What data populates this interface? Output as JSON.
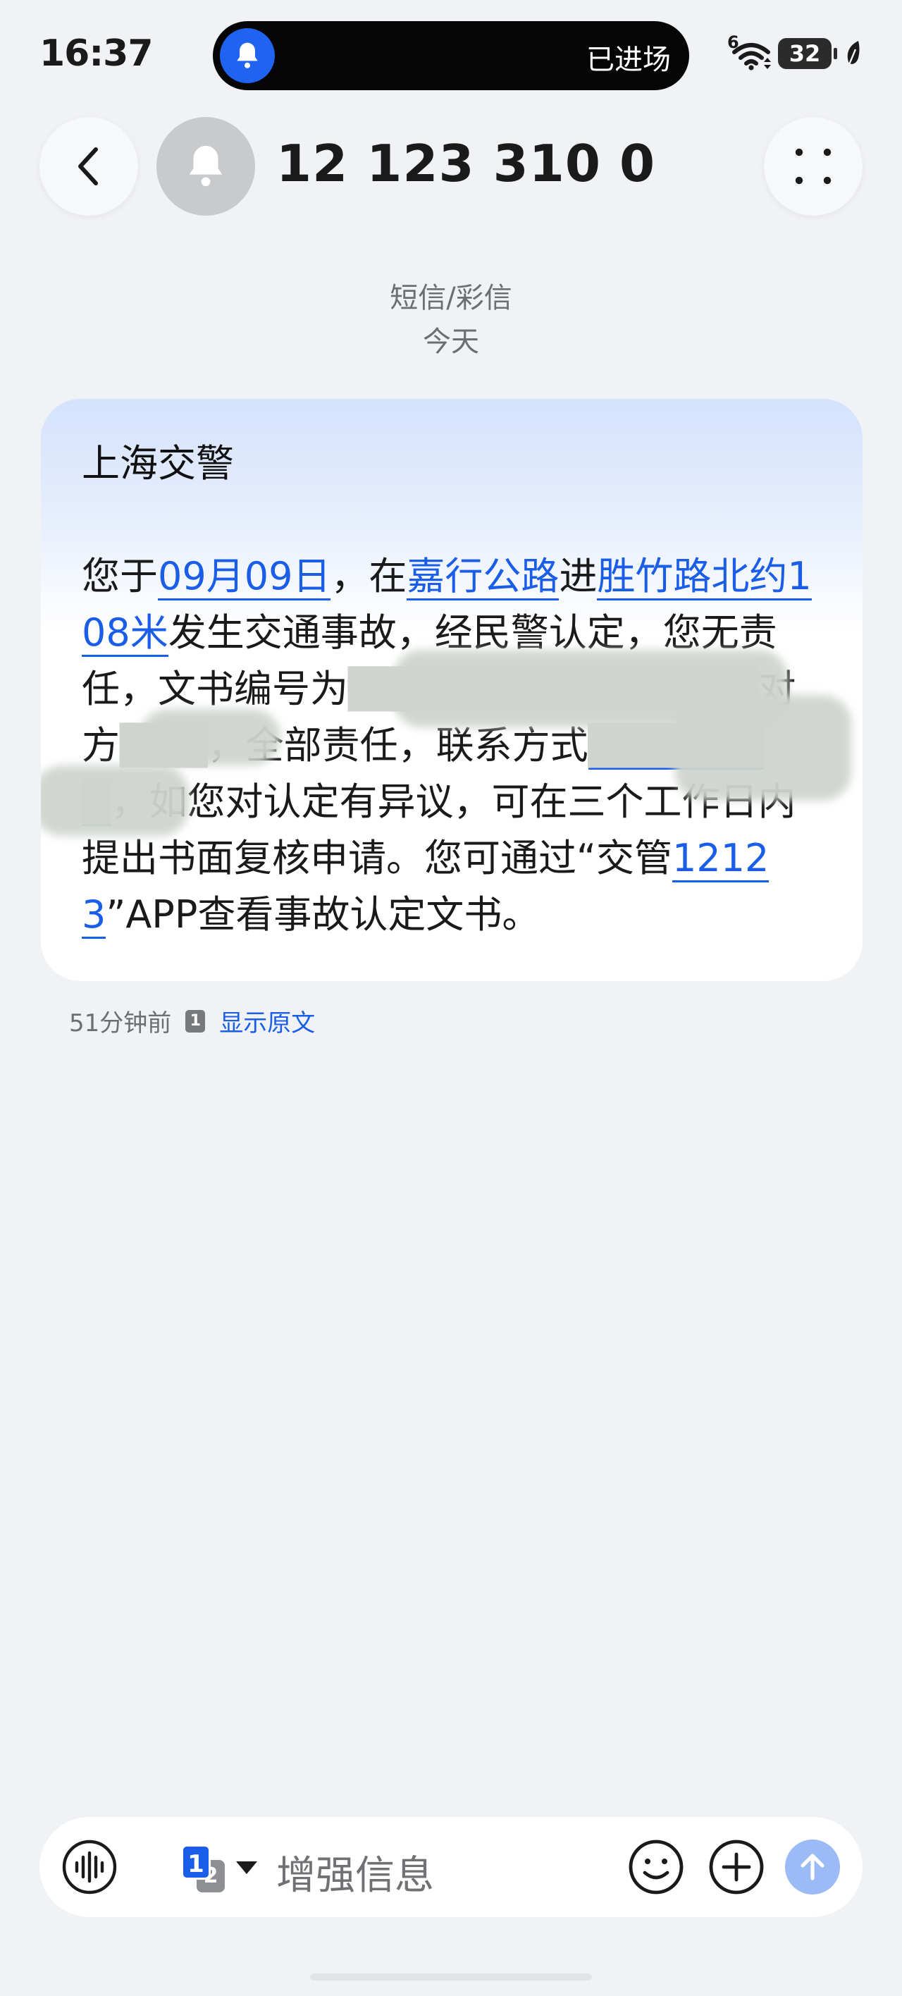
{
  "status_bar": {
    "time": "16:37",
    "island_text": "已进场",
    "network_label": "6",
    "battery_level": "32",
    "icons": [
      "bell-icon",
      "wifi-icon",
      "battery-icon",
      "leaf-icon"
    ]
  },
  "header": {
    "contact_name": "12 123 310 0",
    "icons": [
      "back-chevron-icon",
      "bell-icon",
      "more-dots-icon"
    ]
  },
  "meta": {
    "message_type": "短信/彩信",
    "day": "今天"
  },
  "message": {
    "sender": "上海交警",
    "segments": [
      {
        "text": "您于",
        "link": false
      },
      {
        "text": "09月09日",
        "link": true
      },
      {
        "text": "，在",
        "link": false
      },
      {
        "text": "嘉行公路",
        "link": true
      },
      {
        "text": "进",
        "link": false
      },
      {
        "text": "胜竹路北约108米",
        "link": true
      },
      {
        "text": "发生交通事故，经民警认定，您无责任，文书编号为",
        "link": false
      },
      {
        "text": "██████████████",
        "link": false
      },
      {
        "text": "对方",
        "link": false
      },
      {
        "text": "███",
        "link": false
      },
      {
        "text": "，全部责任，联系方式",
        "link": false
      },
      {
        "text": "███████",
        "link": true
      },
      {
        "text": "，如您对认定有异议，可在三个工作日内提出书面复核申请。您可通过“交管",
        "link": false
      },
      {
        "text": "12123",
        "link": true
      },
      {
        "text": "”APP查看事故认定文书。",
        "link": false
      }
    ]
  },
  "timestamp": {
    "relative_time": "51分钟前",
    "sim_badge": "1",
    "show_original_label": "显示原文"
  },
  "input_bar": {
    "sim_primary": "1",
    "sim_secondary": "2",
    "placeholder": "增强信息",
    "icons": [
      "voice-wave-icon",
      "dropdown-triangle-icon",
      "emoji-icon",
      "plus-icon",
      "send-arrow-icon"
    ]
  },
  "colors": {
    "background": "#f1f2f5",
    "link": "#1a5ee8",
    "island_bell": "#1f63f0",
    "send_button": "#9bbaf6",
    "bubble_top": "#d4e2fd"
  }
}
